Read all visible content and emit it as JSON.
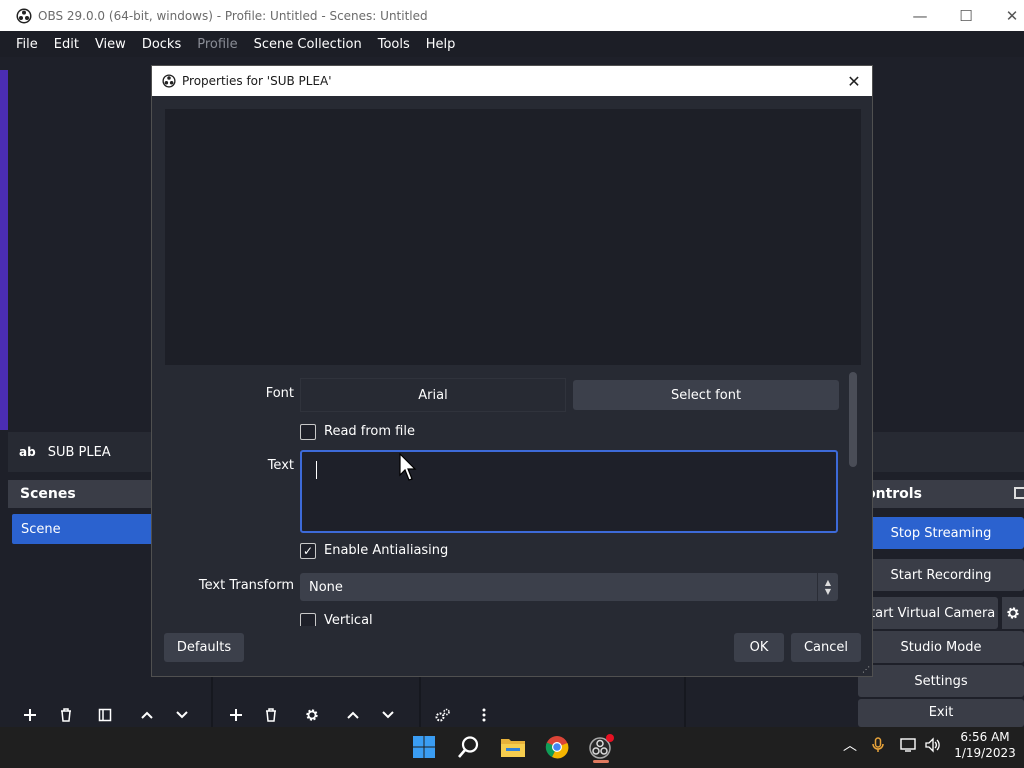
{
  "window": {
    "title": "OBS 29.0.0 (64-bit, windows) - Profile: Untitled - Scenes: Untitled",
    "minimize_glyph": "—",
    "maximize_glyph": "☐",
    "close_glyph": "✕"
  },
  "menubar": {
    "items": [
      "File",
      "Edit",
      "View",
      "Docks",
      "Profile",
      "Scene Collection",
      "Tools",
      "Help"
    ]
  },
  "source_bar": {
    "type_glyph": "ab",
    "name": "SUB PLEA"
  },
  "scenes_dock": {
    "title": "Scenes",
    "items": [
      "Scene"
    ]
  },
  "controls_dock": {
    "title": "ontrols",
    "stop_streaming": "Stop Streaming",
    "start_recording": "Start Recording",
    "start_virtual_camera": "tart Virtual Camera",
    "studio_mode": "Studio Mode",
    "settings": "Settings",
    "exit": "Exit"
  },
  "dialog": {
    "title": "Properties for 'SUB PLEA'",
    "close_glyph": "✕",
    "font_label": "Font",
    "font_value": "Arial",
    "select_font_label": "Select font",
    "read_from_file_label": "Read from file",
    "read_from_file_checked": false,
    "text_label": "Text",
    "text_value": "",
    "enable_antialiasing_label": "Enable Antialiasing",
    "enable_antialiasing_checked": true,
    "text_transform_label": "Text Transform",
    "text_transform_value": "None",
    "vertical_label": "Vertical",
    "vertical_checked": false,
    "defaults_label": "Defaults",
    "ok_label": "OK",
    "cancel_label": "Cancel"
  },
  "taskbar": {
    "time": "6:56 AM",
    "date": "1/19/2023",
    "tray_chevron": "︿"
  },
  "icons": {
    "obs": "obs-logo-icon",
    "windows": "windows-start-icon",
    "search": "search-icon",
    "explorer": "file-explorer-icon",
    "chrome": "chrome-icon",
    "mic": "microphone-icon",
    "network": "network-icon",
    "volume": "volume-icon"
  },
  "colors": {
    "accent": "#2b62cf",
    "background": "#1e2029",
    "panel": "#3a3d47",
    "purple_strip": "#4b2db4"
  }
}
